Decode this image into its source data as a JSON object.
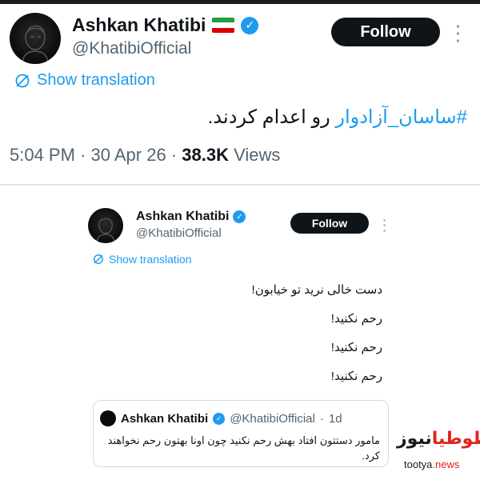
{
  "main_tweet": {
    "author_name": "Ashkan Khatibi",
    "handle": "@KhatibiOfficial",
    "follow_label": "Follow",
    "translate_label": "Show translation",
    "hashtag": "#ساسان_آزادوار",
    "body": " رو اعدام کردند.",
    "time": "5:04 PM",
    "date": "30 Apr 26",
    "views_count": "38.3K",
    "views_label": "Views",
    "separator": " · "
  },
  "embedded_tweet": {
    "author_name": "Ashkan Khatibi",
    "handle": "@KhatibiOfficial",
    "follow_label": "Follow",
    "translate_label": "Show translation",
    "lines": [
      "دست خالی نرید تو خیابون!",
      "رحم نکنید!",
      "رحم نکنید!",
      "رحم نکنید!"
    ],
    "quote": {
      "author_name": "Ashkan Khatibi",
      "handle": "@KhatibiOfficial",
      "separator": " · ",
      "time": "1d",
      "body": "مامور دستتون افتاد بهش رحم نکنید چون اونا بهتون رحم نخواهند کرد."
    }
  },
  "watermark": {
    "logo_part1": "طوطیا",
    "logo_part2": "نیوز",
    "url_part1": "tootya",
    "url_part2": ".news"
  },
  "icons": {
    "verified": "verified-badge-icon",
    "flag": "iran-flag-icon",
    "translate": "translate-icon",
    "more": "more-vertical-icon"
  },
  "colors": {
    "link": "#1d9bf0",
    "button_bg": "#0f1419",
    "muted_text": "#536471",
    "watermark_red": "#e2231a"
  }
}
